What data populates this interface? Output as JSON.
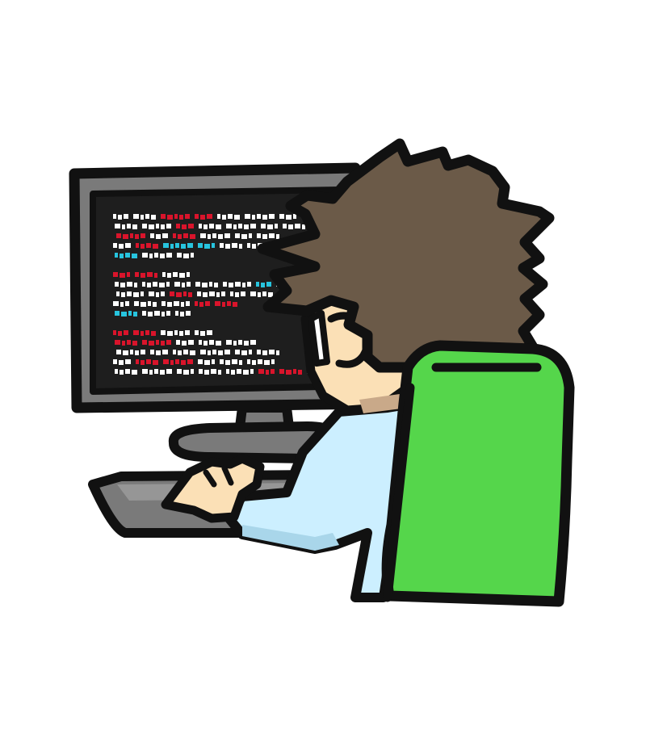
{
  "palette": {
    "background": "#ffffff",
    "outline": "#111111",
    "monitor_bezel": "#7a7a7a",
    "screen": "#1e1e1e",
    "code_white": "#ffffff",
    "code_red": "#d9142b",
    "code_cyan": "#27c4de",
    "hair": "#6b5a48",
    "skin": "#fbe0b6",
    "shirt": "#ccefff",
    "shirt_shadow": "#a9d6ea",
    "chair": "#55d64b",
    "keyboard": "#7a7a7a",
    "keyboard_top": "#969696"
  },
  "code_lines": [
    [
      "w",
      "w",
      "r",
      "r",
      "w",
      "w",
      "w"
    ],
    [
      "w",
      "w",
      "r",
      "w",
      "w",
      "w",
      "w"
    ],
    [
      "r",
      "w",
      "r",
      "w",
      "w",
      "w"
    ],
    [
      "w",
      "r",
      "c",
      "c",
      "w",
      "w"
    ],
    [
      "c",
      "w",
      "w"
    ],
    [],
    [
      "r",
      "r",
      "w"
    ],
    [
      "w",
      "w",
      "w",
      "w",
      "w",
      "c",
      "w"
    ],
    [
      "w",
      "w",
      "r",
      "w",
      "w",
      "w"
    ],
    [
      "w",
      "w",
      "w",
      "r",
      "r"
    ],
    [
      "c",
      "w",
      "w"
    ],
    [],
    [
      "r",
      "r",
      "w",
      "w"
    ],
    [
      "r",
      "r",
      "w",
      "w",
      "w"
    ],
    [
      "w",
      "w",
      "w",
      "w",
      "w",
      "w"
    ],
    [
      "w",
      "r",
      "r",
      "w",
      "w",
      "w"
    ],
    [
      "w",
      "w",
      "w",
      "w",
      "w",
      "r",
      "r",
      "w"
    ]
  ]
}
